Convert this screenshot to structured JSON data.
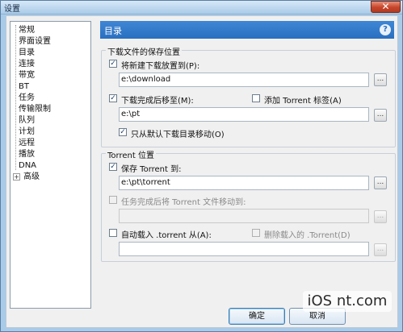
{
  "window": {
    "title": "设置",
    "close_symbol": "✕"
  },
  "tree": {
    "items": [
      "常规",
      "界面设置",
      "目录",
      "连接",
      "带宽",
      "BT",
      "任务",
      "传输限制",
      "队列",
      "计划",
      "远程",
      "播放",
      "DNA",
      "高级"
    ],
    "expander_symbol": "+"
  },
  "header": {
    "title": "目录",
    "help_symbol": "?"
  },
  "download_group": {
    "legend": "下载文件的保存位置",
    "new_downloads_checkbox": {
      "checked": true,
      "label": "将新建下载放置到(P):"
    },
    "new_downloads_path": "e:\\download",
    "move_completed_checkbox": {
      "checked": true,
      "label": "下载完成后移至(M):"
    },
    "add_label_checkbox": {
      "checked": false,
      "label": "添加 Torrent 标签(A)"
    },
    "move_completed_path": "e:\\pt",
    "only_default_checkbox": {
      "checked": true,
      "label": "只从默认下载目录移动(O)"
    }
  },
  "torrent_group": {
    "legend": "Torrent 位置",
    "save_torrent_checkbox": {
      "checked": true,
      "label": "保存 Torrent 到:"
    },
    "save_torrent_path": "e:\\pt\\torrent",
    "move_torrent_checkbox": {
      "checked": false,
      "label": "任务完成后将 Torrent 文件移动到:"
    },
    "move_torrent_path": "",
    "autoload_checkbox": {
      "checked": false,
      "label": "自动载入 .torrent 从(A):"
    },
    "delete_loaded_checkbox": {
      "checked": false,
      "label": "删除载入的 .Torrent(D)"
    },
    "autoload_path": ""
  },
  "browse_label": "...",
  "buttons": {
    "ok": "确定",
    "cancel": "取消"
  },
  "watermark": "iOS nt.com"
}
